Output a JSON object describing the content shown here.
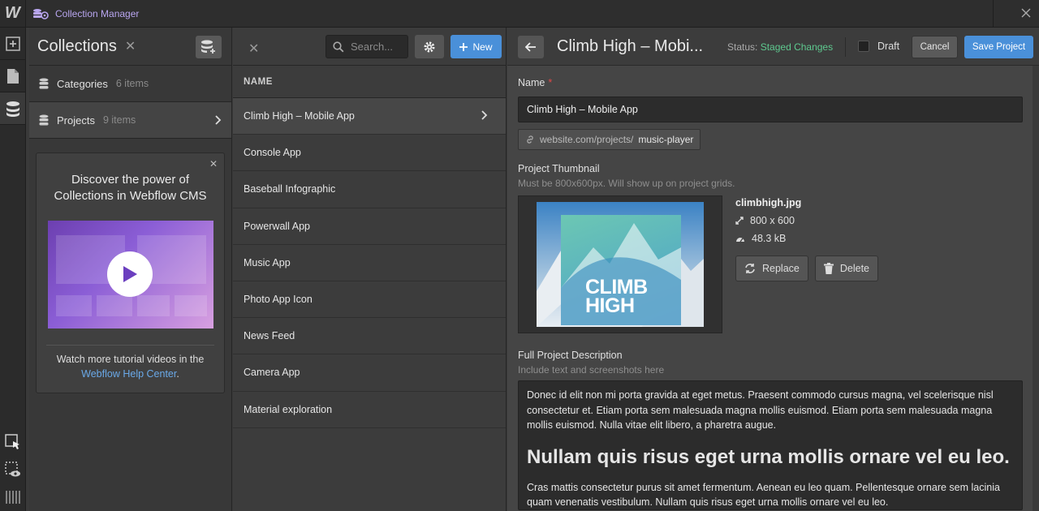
{
  "window": {
    "title": "Collection Manager"
  },
  "collections": {
    "title": "Collections",
    "items": [
      {
        "name": "Categories",
        "count": "6 items"
      },
      {
        "name": "Projects",
        "count": "9 items"
      }
    ],
    "promo": {
      "title": "Discover the power of Collections in Webflow CMS",
      "footer_text": "Watch more tutorial videos in the",
      "footer_link": "Webflow Help Center",
      "footer_end": "."
    }
  },
  "items_panel": {
    "search_placeholder": "Search...",
    "new_label": "New",
    "column_header": "NAME",
    "rows": [
      "Climb High – Mobile App",
      "Console App",
      "Baseball Infographic",
      "Powerwall App",
      "Music App",
      "Photo App Icon",
      "News Feed",
      "Camera App",
      "Material exploration"
    ]
  },
  "editor": {
    "title": "Climb High – Mobi...",
    "status_label": "Status:",
    "status_value": "Staged Changes",
    "draft_label": "Draft",
    "cancel_label": "Cancel",
    "save_label": "Save Project",
    "name_label": "Name",
    "name_value": "Climb High – Mobile App",
    "slug_prefix": "website.com/projects/",
    "slug_value": "music-player",
    "thumb_label": "Project Thumbnail",
    "thumb_hint": "Must be 800x600px. Will show up on project grids.",
    "thumb_text_line1": "CLIMB",
    "thumb_text_line2": "HIGH",
    "file_name": "climbhigh.jpg",
    "file_dims": "800 x 600",
    "file_size": "48.3 kB",
    "replace_label": "Replace",
    "delete_label": "Delete",
    "desc_label": "Full Project Description",
    "desc_hint": "Include text and screenshots here",
    "desc_p1": "Donec id elit non mi porta gravida at eget metus. Praesent commodo cursus magna, vel scelerisque nisl consectetur et. Etiam porta sem malesuada magna mollis euismod. Etiam porta sem malesuada magna mollis euismod. Nulla vitae elit libero, a pharetra augue.",
    "desc_h2": "Nullam quis risus eget urna mollis ornare vel eu leo.",
    "desc_p2": "Cras mattis consectetur purus sit amet fermentum. Aenean eu leo quam. Pellentesque ornare sem lacinia quam venenatis vestibulum. Nullam quis risus eget urna mollis ornare vel eu leo."
  },
  "colors": {
    "accent": "#4a90d9",
    "status": "#5ec98f",
    "link": "#6aa9e8",
    "title": "#b9a6f0"
  }
}
